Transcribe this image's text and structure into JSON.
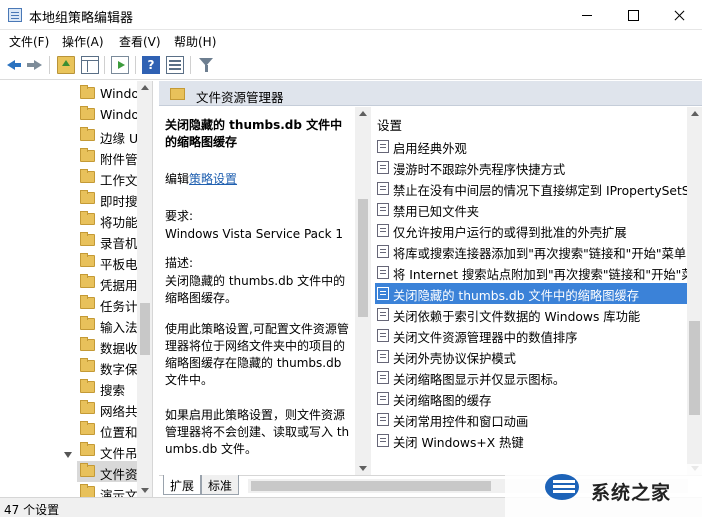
{
  "window": {
    "title": "本地组策略编辑器"
  },
  "menu": [
    "文件(F)",
    "操作(A)",
    "查看(V)",
    "帮助(H)"
  ],
  "toolbar": {
    "icons": [
      "back-arrow-icon",
      "forward-arrow-icon",
      "up-folder-icon",
      "show-hide-tree-icon",
      "export-list-icon",
      "help-icon",
      "properties-icon",
      "filter-icon"
    ],
    "help_glyph": "?"
  },
  "tree": {
    "items": [
      "Windo",
      "Windo",
      "边缘 U",
      "附件管",
      "工作文",
      "即时搜",
      "将功能",
      "录音机",
      "平板电",
      "凭据用",
      "任务计",
      "输入法",
      "数据收",
      "数字保",
      "搜索",
      "网络共",
      "位置和",
      "文件吊",
      "文件资",
      "演示文"
    ],
    "selected_index": 18
  },
  "header": {
    "title": "文件资源管理器"
  },
  "description": {
    "title": "关闭隐藏的 thumbs.db 文件中的缩略图缓存",
    "edit_prefix": "编辑",
    "edit_link": "策略设置",
    "requirements_label": "要求:",
    "requirements_value": "Windows Vista Service Pack 1",
    "description_label": "描述:",
    "description_value": "关闭隐藏的 thumbs.db 文件中的缩略图缓存。",
    "paragraph1": "使用此策略设置,可配置文件资源管理器将位于网络文件夹中的项目的缩略图缓存在隐藏的 thumbs.db 文件中。",
    "paragraph2": "如果启用此策略设置，则文件资源管理器将不会创建、读取或写入 thumbs.db 文件。"
  },
  "settings": {
    "header": "设置",
    "rows": [
      "启用经典外观",
      "漫游时不跟踪外壳程序快捷方式",
      "禁止在没有中间层的情况下直接绑定到 IPropertySetSt",
      "禁用已知文件夹",
      "仅允许按用户运行的或得到批准的外壳扩展",
      "将库或搜索连接器添加到\"再次搜索\"链接和\"开始\"菜单",
      "将 Internet 搜索站点附加到\"再次搜索\"链接和\"开始\"菜",
      "关闭隐藏的 thumbs.db 文件中的缩略图缓存",
      "关闭依赖于索引文件数据的 Windows 库功能",
      "关闭文件资源管理器中的数值排序",
      "关闭外壳协议保护模式",
      "关闭缩略图显示并仅显示图标。",
      "关闭缩略图的缓存",
      "关闭常用控件和窗口动画",
      "关闭 Windows+X 热键"
    ],
    "selected_index": 7
  },
  "tabs": [
    "扩展",
    "标准"
  ],
  "status": {
    "text": "47 个设置"
  },
  "watermark": {
    "text": "系统之家"
  }
}
